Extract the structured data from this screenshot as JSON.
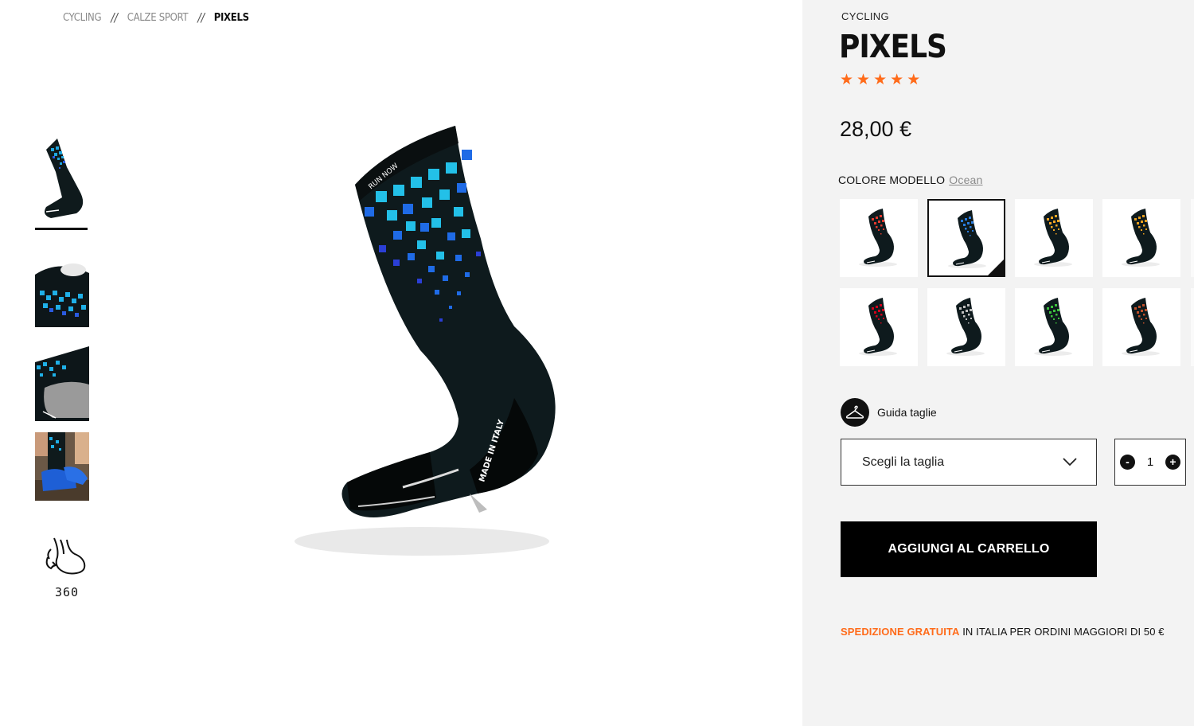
{
  "breadcrumb": {
    "items": [
      "CYCLING",
      "CALZE SPORT",
      "PIXELS"
    ],
    "separator": "//"
  },
  "gallery": {
    "thumbnails": [
      "sock-side-view",
      "sock-top-detail",
      "sock-sole-detail",
      "sock-worn-with-shoes"
    ],
    "active_index": 0,
    "view360_label": "360",
    "main_image": "sock-ocean-pixels"
  },
  "product": {
    "category": "CYCLING",
    "name": "PIXELS",
    "rating": 5,
    "rating_max": 5,
    "star_glyph": "★",
    "price": "28,00 €"
  },
  "color_picker": {
    "label": "COLORE MODELLO",
    "selected_value": "Ocean",
    "swatches": [
      {
        "pattern": "#e03a2e",
        "selected": false
      },
      {
        "pattern": "#2a7de1",
        "selected": true
      },
      {
        "pattern": "#f5a623",
        "selected": false
      },
      {
        "pattern": "#e8a020",
        "selected": false
      },
      {
        "pattern": "#d0021b",
        "selected": false
      },
      {
        "pattern": "#bfbfbf",
        "selected": false
      },
      {
        "pattern": "#3cc23c",
        "selected": false
      },
      {
        "pattern": "#c0502a",
        "selected": false
      }
    ]
  },
  "size_guide": {
    "label": "Guida taglie",
    "icon": "hanger-icon"
  },
  "size_select": {
    "placeholder": "Scegli la taglia",
    "icon": "chevron-down-icon"
  },
  "quantity": {
    "minus": "-",
    "value": "1",
    "plus": "+"
  },
  "add_to_cart": {
    "label": "AGGIUNGI AL CARRELLO"
  },
  "shipping": {
    "highlight": "SPEDIZIONE GRATUITA",
    "text": "IN ITALIA PER ORDINI MAGGIORI DI 50 €"
  },
  "colors": {
    "accent": "#ff6b1a",
    "panel_bg": "#f3f3f3",
    "button_bg": "#000000"
  }
}
